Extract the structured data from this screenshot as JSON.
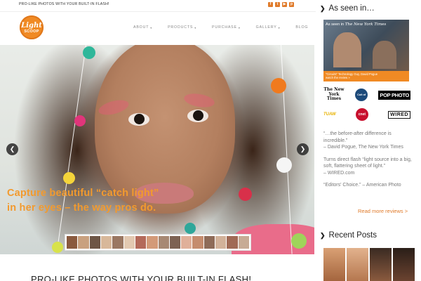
{
  "topbar": {
    "tagline": "PRO-LIKE PHOTOS WITH YOUR BUILT-IN FLASH!",
    "social_icons": [
      "facebook-icon",
      "twitter-icon",
      "youtube-icon",
      "pinterest-icon"
    ],
    "social_glyphs": [
      "f",
      "t",
      "▶",
      "p"
    ]
  },
  "logo": {
    "line1": "Light",
    "line2": "SCOOP"
  },
  "nav": [
    {
      "label": "ABOUT",
      "caret": "▾"
    },
    {
      "label": "PRODUCTS",
      "caret": "▾"
    },
    {
      "label": "PURCHASE",
      "caret": "▾"
    },
    {
      "label": "GALLERY",
      "caret": "▾"
    },
    {
      "label": "BLOG",
      "caret": ""
    }
  ],
  "hero": {
    "line1": "Capture beautiful “catch light”",
    "line2": "in her eyes – the way pros do.",
    "prev_glyph": "❮",
    "next_glyph": "❯"
  },
  "subheading": "PRO-LIKE PHOTOS WITH YOUR BUILT-IN FLASH!",
  "sidebar": {
    "chevron": "❯",
    "as_seen_title": "As seen in…",
    "video_caption_prefix": "As seen in",
    "video_caption_source": "The New York Times",
    "video_bar_line1": "\"Circuits\" Technology Guy, David Pogue",
    "video_bar_line2": "watch the review »",
    "logos_row1": [
      "The New York Times",
      "Cult of Mac",
      "POP PHOTO"
    ],
    "logos_row2": [
      "TUAW",
      "cnet",
      "WIRED"
    ],
    "quotes": [
      {
        "text": "“…the before-after difference is incredible.”",
        "source": "– David Pogue, The New York Times"
      },
      {
        "text": "Turns direct flash “light source into a big, soft, flattering sheet of light.”",
        "source": "– WIRED.com"
      },
      {
        "text": "“Editors' Choice.” – American Photo",
        "source": ""
      }
    ],
    "read_more": "Read more reviews >",
    "recent_posts_title": "Recent Posts"
  },
  "colors": {
    "accent": "#f08a24",
    "hero_text": "#f29a2e",
    "link": "#e07b2b"
  }
}
